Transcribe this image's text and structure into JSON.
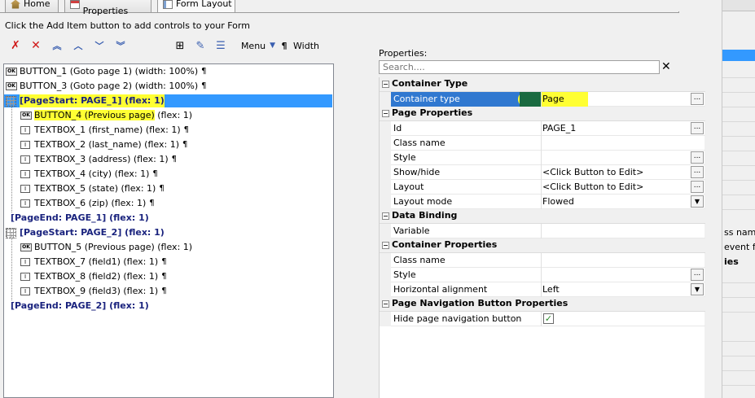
{
  "tabs": [
    {
      "label": "Home",
      "icon": "home-icon"
    },
    {
      "label": "Form Properties",
      "icon": "form-icon"
    },
    {
      "label": "Form Layout",
      "icon": "layout-icon"
    }
  ],
  "hint": "Click the Add Item button to add controls to your Form",
  "toolbar": {
    "menu_label": "Menu",
    "pilcrow": "¶",
    "width_label": "Width"
  },
  "tree": [
    {
      "kind": "button",
      "text": "BUTTON_1 (Goto page 1) (width: 100%)",
      "pilcrow": "¶"
    },
    {
      "kind": "button",
      "text": "BUTTON_3 (Goto page 2) (width: 100%)",
      "pilcrow": "¶"
    },
    {
      "kind": "page",
      "text": "[PageStart: PAGE_1] (flex: 1)",
      "selected": true
    },
    {
      "kind": "button",
      "text": "BUTTON_4 (Previous page) (flex: 1)",
      "highlight": "BUTTON_4 (Previous page)"
    },
    {
      "kind": "textbox",
      "text": "TEXTBOX_1 (first_name) (flex: 1)",
      "pilcrow": "¶"
    },
    {
      "kind": "textbox",
      "text": "TEXTBOX_2 (last_name) (flex: 1)",
      "pilcrow": "¶"
    },
    {
      "kind": "textbox",
      "text": "TEXTBOX_3 (address) (flex: 1)",
      "pilcrow": "¶"
    },
    {
      "kind": "textbox",
      "text": "TEXTBOX_4 (city) (flex: 1)",
      "pilcrow": "¶"
    },
    {
      "kind": "textbox",
      "text": "TEXTBOX_5 (state) (flex: 1)",
      "pilcrow": "¶"
    },
    {
      "kind": "textbox",
      "text": "TEXTBOX_6 (zip) (flex: 1)",
      "pilcrow": "¶"
    },
    {
      "kind": "pageend",
      "text": "[PageEnd: PAGE_1] (flex: 1)"
    },
    {
      "kind": "page",
      "text": "[PageStart: PAGE_2] (flex: 1)"
    },
    {
      "kind": "button",
      "text": "BUTTON_5 (Previous page) (flex: 1)"
    },
    {
      "kind": "textbox",
      "text": "TEXTBOX_7 (field1) (flex: 1)",
      "pilcrow": "¶"
    },
    {
      "kind": "textbox",
      "text": "TEXTBOX_8 (field2) (flex: 1)",
      "pilcrow": "¶"
    },
    {
      "kind": "textbox",
      "text": "TEXTBOX_9 (field3) (flex: 1)",
      "pilcrow": "¶"
    },
    {
      "kind": "pageend",
      "text": "[PageEnd: PAGE_2] (flex: 1)"
    }
  ],
  "properties": {
    "label": "Properties:",
    "search_placeholder": "Search....",
    "clear_glyph": "✕",
    "rows": [
      {
        "type": "category",
        "title": "Container Type"
      },
      {
        "type": "prop",
        "name": "Container type",
        "value": "Page",
        "selected": true,
        "button": "ellipsis"
      },
      {
        "type": "category",
        "title": "Page Properties"
      },
      {
        "type": "prop",
        "name": "Id",
        "value": "PAGE_1",
        "button": "ellipsis"
      },
      {
        "type": "prop",
        "name": "Class name",
        "value": ""
      },
      {
        "type": "prop",
        "name": "Style",
        "value": "",
        "button": "ellipsis"
      },
      {
        "type": "prop",
        "name": "Show/hide",
        "value": "<Click Button to Edit>",
        "button": "ellipsis"
      },
      {
        "type": "prop",
        "name": "Layout",
        "value": "<Click Button to Edit>",
        "button": "ellipsis"
      },
      {
        "type": "prop",
        "name": "Layout mode",
        "value": "Flowed",
        "button": "dropdown"
      },
      {
        "type": "category",
        "title": "Data Binding"
      },
      {
        "type": "prop",
        "name": "Variable",
        "value": ""
      },
      {
        "type": "category",
        "title": "Container Properties"
      },
      {
        "type": "prop",
        "name": "Class name",
        "value": ""
      },
      {
        "type": "prop",
        "name": "Style",
        "value": "",
        "button": "ellipsis"
      },
      {
        "type": "prop",
        "name": "Horizontal alignment",
        "value": "Left",
        "button": "dropdown"
      },
      {
        "type": "category",
        "title": "Page Navigation Button Properties"
      },
      {
        "type": "prop",
        "name": "Hide page navigation button",
        "value": "",
        "checkbox": true
      }
    ]
  },
  "right_strip": {
    "text1": "ss name",
    "text2": "event flo",
    "text3": "ies"
  },
  "colors": {
    "selection": "#3399ff",
    "highlight": "#ffff33",
    "page_text": "#1a237e",
    "prop_selected": "#3078d0"
  }
}
